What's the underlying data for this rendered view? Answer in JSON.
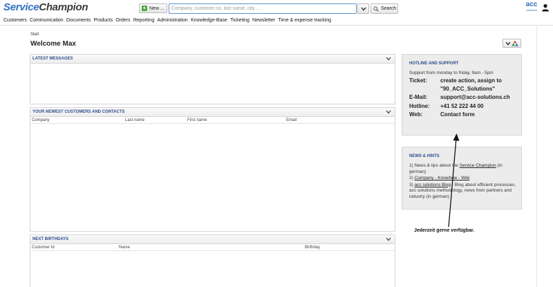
{
  "app": {
    "logo_part1": "Service",
    "logo_part2": "Champion",
    "brand_logo_big": "acc",
    "brand_logo_small": "solutions"
  },
  "toolbar": {
    "new_label": "New ...",
    "search_placeholder": "Company, customer no, last name, city ...",
    "search_label": "Search"
  },
  "menu": {
    "items": [
      "Customers",
      "Communication",
      "Documents",
      "Products",
      "Orders",
      "Reporting",
      "Administration",
      "Knowledge-Base",
      "Ticketing",
      "Newsletter",
      "Time & expense tracking"
    ]
  },
  "page": {
    "breadcrumb": "Start",
    "title": "Welcome Max"
  },
  "panels": {
    "messages": {
      "title": "LATEST MESSAGES"
    },
    "customers": {
      "title": "YOUR NEWEST CUSTOMERS AND CONTACTS",
      "columns": [
        "Company",
        "Last name",
        "First name",
        "Email"
      ]
    },
    "birthdays": {
      "title": "NEXT BIRTHDAYS",
      "columns": [
        "Customer Id",
        "Name",
        "Birthday"
      ]
    }
  },
  "hotline": {
    "title": "HOTLINE AND SUPPORT",
    "intro": "Support from monday to friday, 9am - 5pm",
    "rows": [
      {
        "key": "Ticket:",
        "value": "create action, assign to \"90_ACC_Solutions\""
      },
      {
        "key": "E-Mail:",
        "value": "support@acc-solutions.ch"
      },
      {
        "key": "Hotline:",
        "value": "+41 52 222 44 00"
      },
      {
        "key": "Web:",
        "value": "Contact form"
      }
    ]
  },
  "news": {
    "title": "NEWS & HINTS",
    "item1_prefix": "1) News & tips about the ",
    "item1_link": "Service Champion",
    "item1_suffix": " (in german)",
    "item2_prefix": "2) ",
    "item2_link": "Company - Knowhow - Wiki",
    "item3_prefix": "3) ",
    "item3_link": "acc solutions Blog",
    "item3_suffix": " - Blog about efficient processes, acc solutions methodology, news from partners and industry (in german)"
  },
  "annotation": {
    "note": "Jederzeit gerne verfügbar."
  },
  "colors": {
    "accent_blue": "#2f72c4",
    "panel_title": "#2d4c8d",
    "new_plus": "#4aa83a"
  }
}
